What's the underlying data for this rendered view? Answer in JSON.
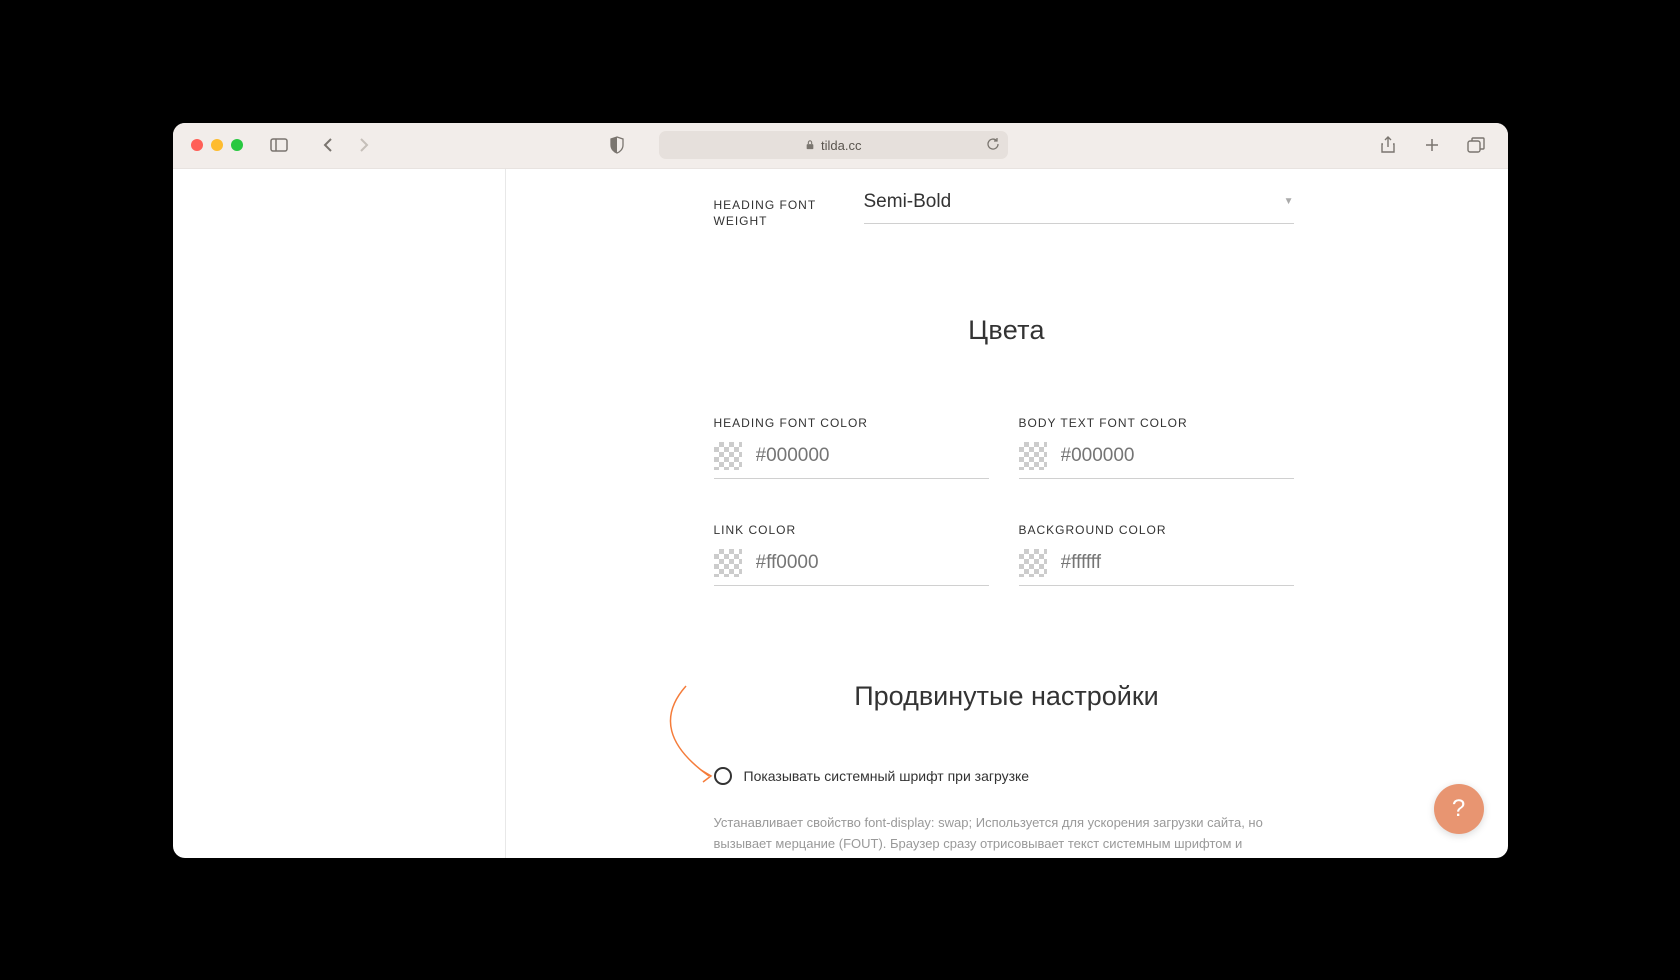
{
  "browser": {
    "url": "tilda.cc"
  },
  "font_settings": {
    "heading_weight_label": "HEADING FONT WEIGHT",
    "heading_weight_value": "Semi-Bold"
  },
  "colors_section": {
    "heading": "Цвета",
    "fields": {
      "heading_color": {
        "label": "HEADING FONT COLOR",
        "placeholder": "#000000"
      },
      "body_color": {
        "label": "BODY TEXT FONT COLOR",
        "placeholder": "#000000"
      },
      "link_color": {
        "label": "LINK COLOR",
        "placeholder": "#ff0000"
      },
      "bg_color": {
        "label": "BACKGROUND COLOR",
        "placeholder": "#ffffff"
      }
    }
  },
  "advanced_section": {
    "heading": "Продвинутые настройки",
    "checkbox_label": "Показывать системный шрифт при загрузке",
    "help_text": "Устанавливает свойство font-display: swap; Используется для ускорения загрузки сайта, но вызывает мерцание (FOUT). Браузер сразу отрисовывает текст системным шрифтом и посетитель не видит пустого экрана дожидаясь загрузки шрифта. Когда шрифт загрузится, он сразу заменяется."
  },
  "help_fab": {
    "label": "?"
  }
}
